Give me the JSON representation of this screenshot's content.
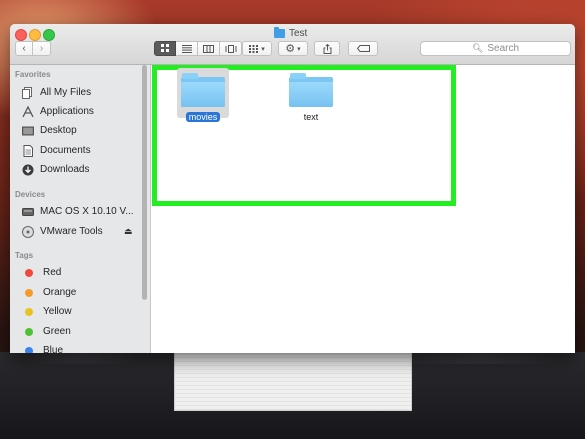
{
  "window": {
    "title": "Test"
  },
  "toolbar": {
    "back_label": "‹",
    "forward_label": "›",
    "view_icons": [
      "icon-view-icon",
      "list-view-icon",
      "column-view-icon",
      "coverflow-view-icon"
    ],
    "search_placeholder": "Search"
  },
  "sidebar": {
    "favorites_header": "Favorites",
    "favorites": [
      {
        "label": "All My Files",
        "icon": "all-files-icon"
      },
      {
        "label": "Applications",
        "icon": "applications-icon"
      },
      {
        "label": "Desktop",
        "icon": "desktop-icon"
      },
      {
        "label": "Documents",
        "icon": "documents-icon"
      },
      {
        "label": "Downloads",
        "icon": "downloads-icon"
      }
    ],
    "devices_header": "Devices",
    "devices": [
      {
        "label": "MAC OS X 10.10 V...",
        "icon": "disk-icon"
      },
      {
        "label": "VMware Tools",
        "icon": "disc-icon",
        "eject": "⏏"
      }
    ],
    "tags_header": "Tags",
    "tags": [
      {
        "label": "Red",
        "color": "#f04a3f"
      },
      {
        "label": "Orange",
        "color": "#f79a2a"
      },
      {
        "label": "Yellow",
        "color": "#e8c31f"
      },
      {
        "label": "Green",
        "color": "#4fc233"
      },
      {
        "label": "Blue",
        "color": "#3b82ec"
      }
    ]
  },
  "content": {
    "items": [
      {
        "label": "movies",
        "selected": true
      },
      {
        "label": "text",
        "selected": false
      }
    ],
    "highlight_color": "#22ee22"
  }
}
